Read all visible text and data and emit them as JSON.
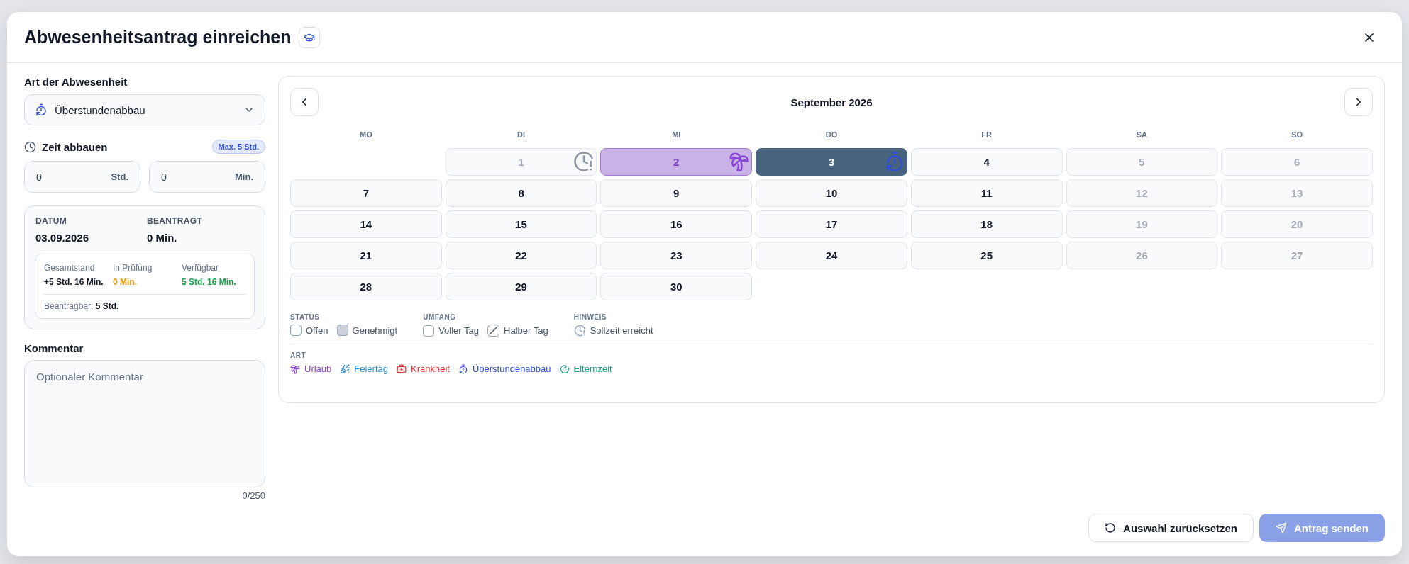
{
  "dialog": {
    "title": "Abwesenheitsantrag einreichen"
  },
  "form": {
    "type_label": "Art der Abwesenheit",
    "type_value": "Überstundenabbau",
    "time_label": "Zeit abbauen",
    "time_badge": "Max. 5 Std.",
    "inputs": [
      {
        "value": "0",
        "unit": "Std."
      },
      {
        "value": "0",
        "unit": "Min."
      }
    ],
    "summary": {
      "fields": [
        {
          "label": "DATUM",
          "value": "03.09.2026"
        },
        {
          "label": "BEANTRAGT",
          "value": "0 Min."
        }
      ],
      "stats": [
        {
          "label": "Gesamtstand",
          "value": "+5 Std. 16 Min.",
          "color": "#111827"
        },
        {
          "label": "In Prüfung",
          "value": "0 Min.",
          "color": "#e8900c"
        },
        {
          "label": "Verfügbar",
          "value": "5 Std. 16 Min.",
          "color": "#16a34a"
        }
      ],
      "footnote": "Beantragbar: **5 Std.**"
    },
    "comment_label": "Kommentar",
    "comment_placeholder": "Optionaler Kommentar",
    "comment_counter": "0/250"
  },
  "calendar": {
    "month": "September 2026",
    "weekdays": [
      "MO",
      "DI",
      "MI",
      "DO",
      "FR",
      "SA",
      "SO"
    ],
    "weeks": [
      [
        {
          "label": "1",
          "disabled": true,
          "selected": false,
          "kind": "sollzeit"
        },
        {
          "label": "2",
          "disabled": false,
          "selected": false,
          "kind": "urlaub"
        },
        {
          "label": "3",
          "disabled": false,
          "selected": true,
          "kind": "ueberstunden"
        },
        {
          "label": "4",
          "disabled": false,
          "selected": false
        },
        {
          "label": "5",
          "disabled": true,
          "selected": false
        },
        {
          "label": "6",
          "disabled": true,
          "selected": false
        }
      ],
      [
        {
          "label": "7",
          "disabled": false,
          "selected": false
        },
        {
          "label": "8",
          "disabled": false,
          "selected": false
        },
        {
          "label": "9",
          "disabled": false,
          "selected": false
        },
        {
          "label": "10",
          "disabled": false,
          "selected": false
        },
        {
          "label": "11",
          "disabled": false,
          "selected": false
        },
        {
          "label": "12",
          "disabled": true,
          "selected": false
        },
        {
          "label": "13",
          "disabled": true,
          "selected": false
        }
      ],
      [
        {
          "label": "14",
          "disabled": false,
          "selected": false
        },
        {
          "label": "15",
          "disabled": false,
          "selected": false
        },
        {
          "label": "16",
          "disabled": false,
          "selected": false
        },
        {
          "label": "17",
          "disabled": false,
          "selected": false
        },
        {
          "label": "18",
          "disabled": false,
          "selected": false
        },
        {
          "label": "19",
          "disabled": true,
          "selected": false
        },
        {
          "label": "20",
          "disabled": true,
          "selected": false
        }
      ],
      [
        {
          "label": "21",
          "disabled": false,
          "selected": false
        },
        {
          "label": "22",
          "disabled": false,
          "selected": false
        },
        {
          "label": "23",
          "disabled": false,
          "selected": false
        },
        {
          "label": "24",
          "disabled": false,
          "selected": false
        },
        {
          "label": "25",
          "disabled": false,
          "selected": false
        },
        {
          "label": "26",
          "disabled": true,
          "selected": false
        },
        {
          "label": "27",
          "disabled": true,
          "selected": false
        }
      ],
      [
        {
          "label": "28",
          "disabled": false,
          "selected": false
        },
        {
          "label": "29",
          "disabled": false,
          "selected": false
        },
        {
          "label": "30",
          "disabled": false,
          "selected": false
        }
      ]
    ]
  },
  "legend": {
    "groups": [
      {
        "title": "STATUS",
        "items": [
          {
            "label": "Offen",
            "kind": "offen"
          },
          {
            "label": "Genehmigt",
            "kind": "genehmigt"
          }
        ]
      },
      {
        "title": "UMFANG",
        "items": [
          {
            "label": "Voller Tag",
            "kind": "voll"
          },
          {
            "label": "Halber Tag",
            "kind": "halb"
          }
        ]
      },
      {
        "title": "HINWEIS",
        "items": [
          {
            "label": "Sollzeit erreicht",
            "kind": "sollzeit"
          }
        ]
      }
    ],
    "art_title": "ART",
    "art": [
      {
        "label": "Urlaub",
        "kind": "urlaub",
        "color": "#8b46d6"
      },
      {
        "label": "Feiertag",
        "kind": "feiertag",
        "color": "#2b8bd8"
      },
      {
        "label": "Krankheit",
        "kind": "krankheit",
        "color": "#dc2f2f"
      },
      {
        "label": "Überstundenabbau",
        "kind": "ueberstunden",
        "color": "#2f4fd6"
      },
      {
        "label": "Elternzeit",
        "kind": "elternzeit",
        "color": "#16a08a"
      }
    ]
  },
  "buttons": [
    {
      "label": "Auswahl zurücksetzen",
      "kind": "reset",
      "disabled": false
    },
    {
      "label": "Antrag senden",
      "kind": "send",
      "disabled": true
    }
  ]
}
